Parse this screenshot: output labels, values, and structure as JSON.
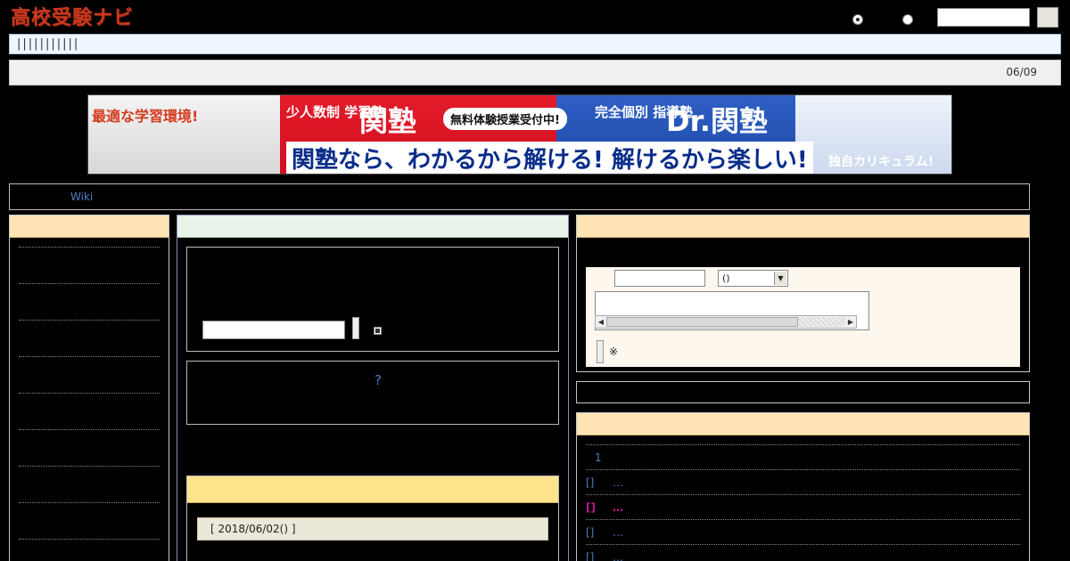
{
  "header": {
    "logo_text": "高校受験ナビ",
    "search_placeholder": ""
  },
  "nav": {
    "items": [
      "|",
      "|",
      "|",
      "|",
      "|",
      "|",
      "|",
      "|",
      "|",
      "|",
      "|"
    ]
  },
  "news": {
    "date": "06/09"
  },
  "banner": {
    "tagline_left": "最適な学習環境!",
    "school1_small": "少人数制 学習塾",
    "school1_name": "関塾",
    "badge": "無料体験授業受付中!",
    "school2_small": "完全個別 指導塾",
    "school2_name": "Dr.関塾",
    "slogan": "関塾なら、わかるから解ける! 解けるから楽しい!",
    "tagline_right": "独自カリキュラム!"
  },
  "path": {
    "link": "Wiki"
  },
  "center": {
    "help_mark": "?",
    "entry_date": "[ 2018/06/02() ]"
  },
  "form": {
    "select_value": "()",
    "note": "※"
  },
  "ranking": {
    "first": "1",
    "items": [
      {
        "bracket": "[]",
        "text": "…",
        "hot": false
      },
      {
        "bracket": "[]",
        "text": "…",
        "hot": true
      },
      {
        "bracket": "[]",
        "text": "…",
        "hot": false
      },
      {
        "bracket": "[]",
        "text": "…",
        "hot": false
      }
    ]
  },
  "colors": {
    "accent_red": "#c8391e",
    "link_blue": "#4a7fc0",
    "hot_magenta": "#c0168a"
  }
}
